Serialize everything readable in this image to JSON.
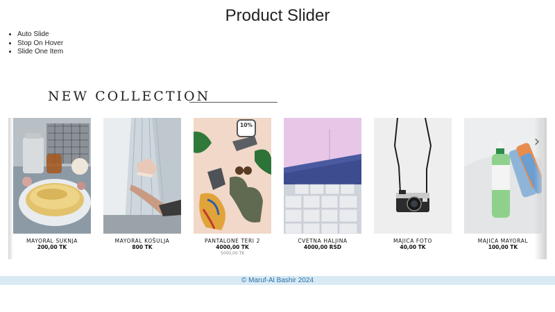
{
  "page": {
    "title": "Product Slider",
    "features": [
      "Auto Slide",
      "Stop On Hover",
      "Slide One Item"
    ]
  },
  "section": {
    "heading": "NEW COLLECTION"
  },
  "slider": {
    "next_icon": "chevron-right-icon",
    "next_glyph": "›",
    "products": [
      {
        "name": "MAYORAL SUKNJA",
        "price": "200,00 TK",
        "image": "pancakes-kitchen"
      },
      {
        "name": "MAYORAL KOŠULJA",
        "price": "800 TK",
        "image": "hand-holding-sneaker"
      },
      {
        "name": "PANTALONE TERI 2",
        "price": "4000,00 TK",
        "old_price": "5000,00 TK",
        "badge": "10%",
        "image": "flatlay-accessories"
      },
      {
        "name": "CVETNA HALJINA",
        "price": "4000,00 RSD",
        "image": "pallets-building"
      },
      {
        "name": "MAJICA FOTO",
        "price": "40,00 TK",
        "image": "hanging-camera"
      },
      {
        "name": "MAJICA MAYORAL",
        "price": "100,00 TK",
        "image": "spray-bottles"
      }
    ]
  },
  "footer": {
    "copyright": "©",
    "author": "Maruf-Al Bashir",
    "year": "2024"
  },
  "colors": {
    "footer_bg": "#d9eaf5",
    "footer_text": "#2a6fa8"
  }
}
